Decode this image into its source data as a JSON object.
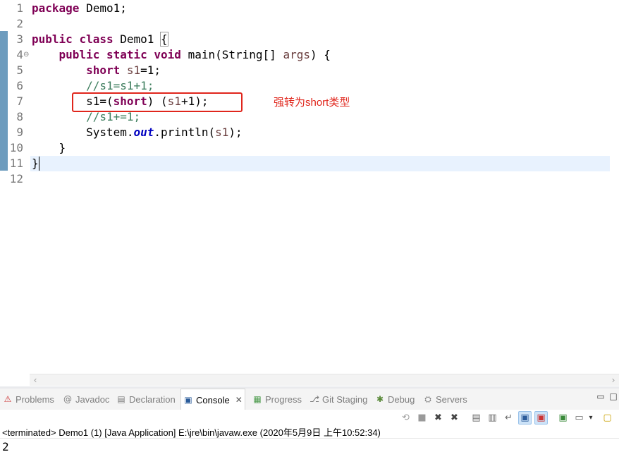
{
  "editor": {
    "line_numbers": [
      "1",
      "2",
      "3",
      "4",
      "5",
      "6",
      "7",
      "8",
      "9",
      "10",
      "11",
      "12"
    ],
    "fold_icon": "collapse-icon",
    "code": {
      "l1_kw": "package",
      "l1_rest": " Demo1;",
      "l3_kw1": "public",
      "l3_kw2": "class",
      "l3_name": " Demo1 ",
      "l3_brace": "{",
      "l4_kw1": "public",
      "l4_kw2": "static",
      "l4_kw3": "void",
      "l4_sig": " main(String[] ",
      "l4_param": "args",
      "l4_end": ") {",
      "l5_kw": "short",
      "l5_var": "s1",
      "l5_end": "=1;",
      "l6_comment": "//s1=s1+1;",
      "l7_a": "s1=(",
      "l7_kw": "short",
      "l7_b": ") (",
      "l7_var": "s1",
      "l7_c": "+1);",
      "l8_comment": "//s1+=1;",
      "l9_a": "System.",
      "l9_field": "out",
      "l9_b": ".println(",
      "l9_var": "s1",
      "l9_c": ");",
      "l10": "}",
      "l11": "}"
    },
    "annotation": "强转为short类型",
    "current_line": "11"
  },
  "panel": {
    "tabs": [
      {
        "label": "Problems",
        "icon": "problems-icon"
      },
      {
        "label": "Javadoc",
        "icon": "javadoc-icon"
      },
      {
        "label": "Declaration",
        "icon": "declaration-icon"
      },
      {
        "label": "Console",
        "icon": "console-icon",
        "active": true
      },
      {
        "label": "Progress",
        "icon": "progress-icon"
      },
      {
        "label": "Git Staging",
        "icon": "git-staging-icon"
      },
      {
        "label": "Debug",
        "icon": "debug-icon"
      },
      {
        "label": "Servers",
        "icon": "servers-icon"
      }
    ],
    "toolbar_icons": [
      "link-icon",
      "stop-icon",
      "remove-launch-icon",
      "remove-all-icon",
      "clear-console-icon",
      "scroll-lock-icon",
      "word-wrap-icon",
      "show-on-stdout-icon",
      "show-on-stderr-icon",
      "pin-console-icon",
      "display-console-icon",
      "dropdown-icon",
      "open-console-icon"
    ],
    "console_header": "<terminated> Demo1 (1) [Java Application] E:\\jre\\bin\\javaw.exe (2020年5月9日 上午10:52:34)",
    "console_output": "2"
  },
  "colors": {
    "keyword": "#7f0055",
    "comment": "#3f7f5f",
    "variable": "#6a3e3e",
    "static_field": "#0000c0",
    "annotation_red": "#e0261c",
    "current_line_bg": "#e8f2fe",
    "change_ruler": "#6d9cbe"
  }
}
